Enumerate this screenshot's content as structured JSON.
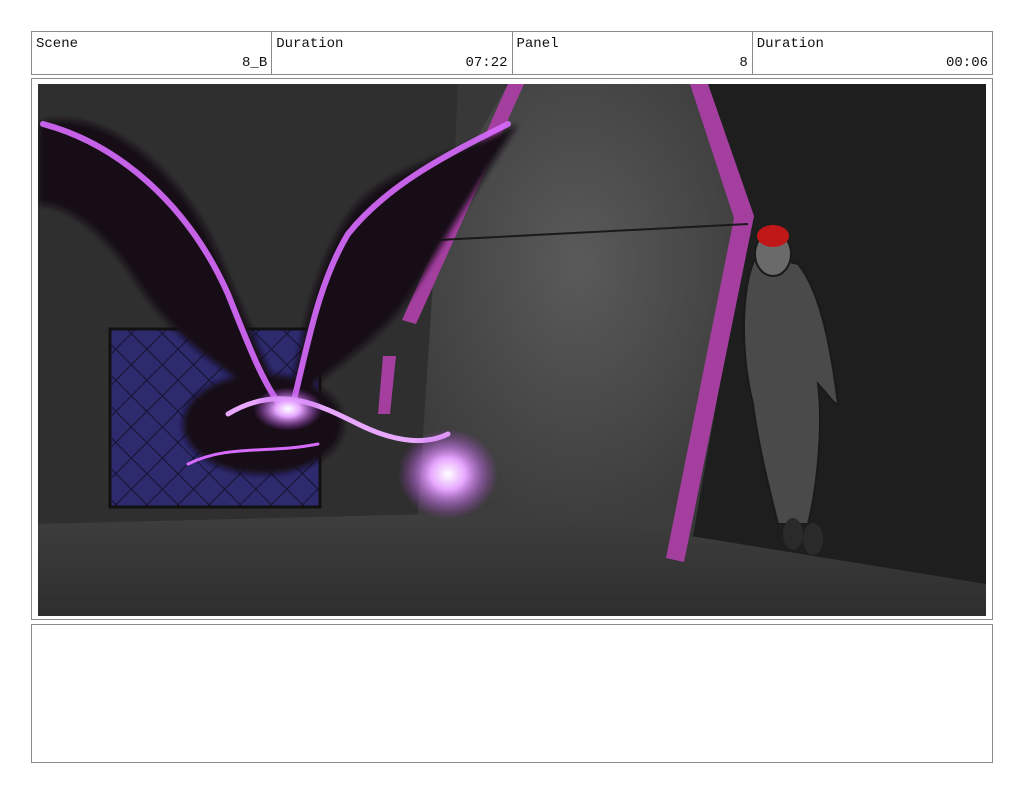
{
  "header": {
    "scene_label": "Scene",
    "scene_value": "8_B",
    "duration_label": "Duration",
    "duration_value": "07:22",
    "panel_label": "Panel",
    "panel_value": "8",
    "panel_duration_label": "Duration",
    "panel_duration_value": "00:06"
  },
  "panel": {
    "accent_color": "#a43fa0",
    "glow_color": "#d86bff",
    "grate_color": "#2e2a6e",
    "hair_color": "#c01818",
    "background_color": "#3a3a3a"
  },
  "notes": {
    "text": ""
  }
}
